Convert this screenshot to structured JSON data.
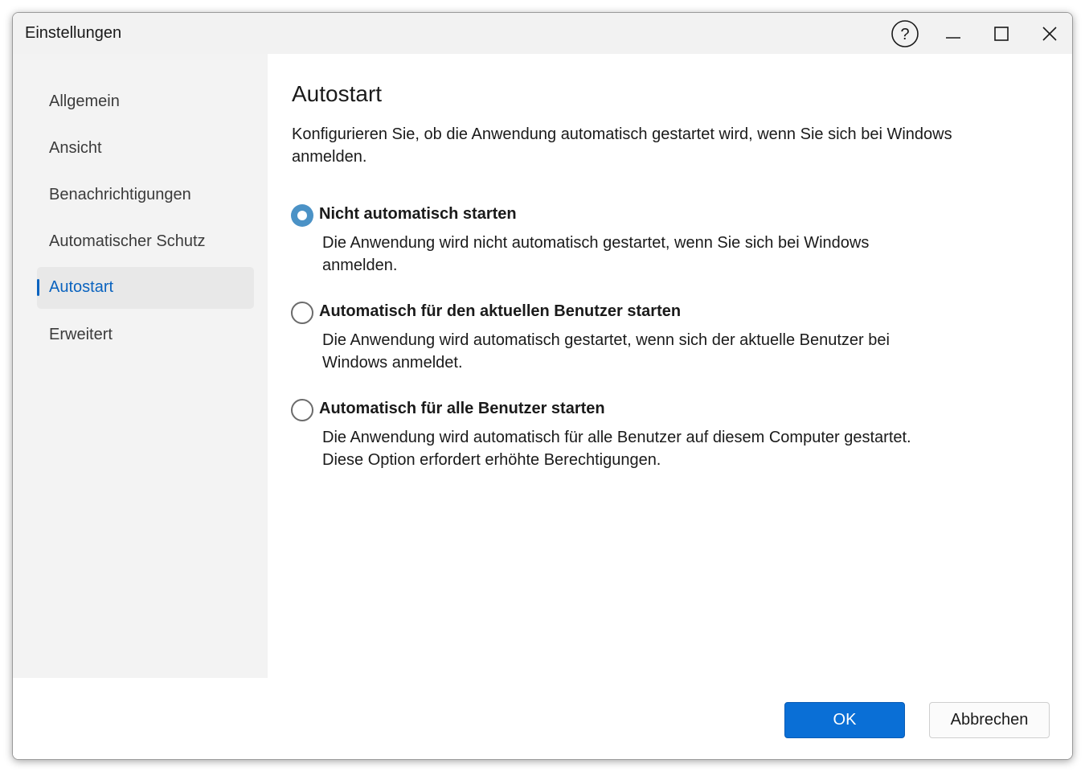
{
  "window": {
    "title": "Einstellungen"
  },
  "sidebar": {
    "items": [
      {
        "label": "Allgemein",
        "active": false
      },
      {
        "label": "Ansicht",
        "active": false
      },
      {
        "label": "Benachrichtigungen",
        "active": false
      },
      {
        "label": "Automatischer Schutz",
        "active": false
      },
      {
        "label": "Autostart",
        "active": true
      },
      {
        "label": "Erweitert",
        "active": false
      }
    ]
  },
  "main": {
    "heading": "Autostart",
    "intro": "Konfigurieren Sie, ob die Anwendung automatisch gestartet wird, wenn Sie sich bei Windows anmelden.",
    "options": [
      {
        "label": "Nicht automatisch starten",
        "description": "Die Anwendung wird nicht automatisch gestartet, wenn Sie sich bei Windows anmelden.",
        "checked": true
      },
      {
        "label": "Automatisch für den aktuellen Benutzer starten",
        "description": "Die Anwendung wird automatisch gestartet, wenn sich der aktuelle Benutzer bei Windows anmeldet.",
        "checked": false
      },
      {
        "label": "Automatisch für alle Benutzer starten",
        "description": "Die Anwendung wird automatisch für alle Benutzer auf diesem Computer gestartet. Diese Option erfordert erhöhte Berechtigungen.",
        "checked": false
      }
    ]
  },
  "footer": {
    "ok_label": "OK",
    "cancel_label": "Abbrechen"
  },
  "colors": {
    "accent": "#0a63bf",
    "primary_button": "#0a6fd6",
    "radio_checked": "#4b92c6",
    "sidebar_bg": "#f3f3f3",
    "titlebar_bg": "#f2f2f2"
  },
  "icons": {
    "help": "help-icon",
    "minimize": "minimize-icon",
    "maximize": "maximize-icon",
    "close": "close-icon"
  }
}
